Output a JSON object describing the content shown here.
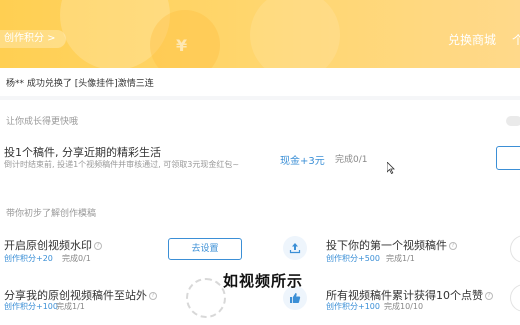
{
  "header": {
    "pill_label": "创作积分 >",
    "shop_link": "兑换商城",
    "edge_text": "个"
  },
  "ticker": "杨** 成功兑换了 [头像挂件]激情三连",
  "sections": {
    "growth_label": "让你成长得更快哦",
    "learn_label": "带你初步了解创作模稿"
  },
  "task_main": {
    "title": "投1个稿件, 分享近期的精彩生活",
    "desc": "倒计时结束前, 投递1个视频稿件并审核通过, 可领取3元现金红包~",
    "reward": "现金+3元",
    "status": "完成0/1"
  },
  "tasks": [
    {
      "title": "开启原创视频水印",
      "reward": "创作积分+20",
      "status": "完成0/1",
      "button": "去设置"
    },
    {
      "title": "投下你的第一个视频稿件",
      "reward": "创作积分+500",
      "status": "完成1/1"
    },
    {
      "title": "分享我的原创视频稿件至站外",
      "reward": "创作积分+100",
      "status": "完成1/1"
    },
    {
      "title": "所有视频稿件累计获得10个点赞",
      "reward": "创作积分+100",
      "status": "完成10/10"
    }
  ],
  "overlay_caption": "如视频所示",
  "icons": {
    "upload": "upload-icon",
    "thumbs_up": "thumbs-up-icon",
    "help": "question-icon",
    "cursor": "mouse-cursor-icon"
  },
  "colors": {
    "header_yellow": "#ffcf52",
    "accent_blue": "#3b8fd6"
  }
}
